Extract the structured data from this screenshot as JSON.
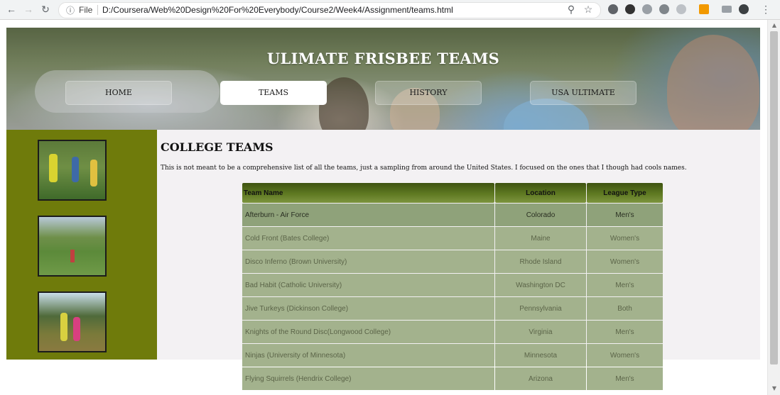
{
  "browser": {
    "info_label": "File",
    "url": "D:/Coursera/Web%20Design%20For%20Everybody/Course2/Week4/Assignment/teams.html"
  },
  "site": {
    "title": "ULIMATE FRISBEE TEAMS",
    "menu": [
      "HOME",
      "TEAMS",
      "HISTORY",
      "USA ULTIMATE"
    ],
    "active_menu": "TEAMS"
  },
  "main": {
    "heading": "COLLEGE TEAMS",
    "intro": "This is not meant to be a comprehensive list of all the teams, just a sampling from around the United States. I focused on the ones that I though had cools names."
  },
  "table": {
    "headers": [
      "Team Name",
      "Location",
      "League Type"
    ],
    "rows": [
      [
        "Afterburn - Air Force",
        "Colorado",
        "Men's"
      ],
      [
        "Cold Front (Bates College)",
        "Maine",
        "Women's"
      ],
      [
        "Disco Inferno (Brown University)",
        "Rhode Island",
        "Women's"
      ],
      [
        "Bad Habit (Catholic University)",
        "Washington DC",
        "Men's"
      ],
      [
        "Jive Turkeys (Dickinson College)",
        "Pennsylvania",
        "Both"
      ],
      [
        "Knights of the Round Disc(Longwood College)",
        "Virginia",
        "Men's"
      ],
      [
        "Ninjas (University of Minnesota)",
        "Minnesota",
        "Women's"
      ],
      [
        "Flying Squirrels (Hendrix College)",
        "Arizona",
        "Men's"
      ]
    ]
  },
  "colors": {
    "sidebar": "#6f7b0b",
    "main_bg": "#f3f1f3",
    "table_cell": "#a3b28d",
    "table_header": "#4a6018"
  },
  "icons": [
    "back-icon",
    "forward-icon",
    "reload-icon",
    "info-icon",
    "zoom-icon",
    "star-icon",
    "extension-icon",
    "menu-dots-icon"
  ]
}
